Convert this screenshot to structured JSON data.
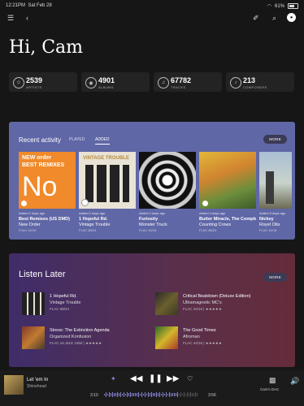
{
  "status": {
    "time": "12:21PM",
    "date": "Sat Feb 28",
    "battery": "61%"
  },
  "greeting": "Hi, Cam",
  "stats": [
    {
      "value": "2539",
      "label": "ARTISTS",
      "icon": "person-icon"
    },
    {
      "value": "4901",
      "label": "ALBUMS",
      "icon": "disc-icon"
    },
    {
      "value": "67782",
      "label": "TRACKS",
      "icon": "music-note-icon"
    },
    {
      "value": "213",
      "label": "COMPOSERS",
      "icon": "composer-icon"
    }
  ],
  "recent": {
    "title": "Recent activity",
    "tabs": [
      "PLAYED",
      "ADDED"
    ],
    "active_tab": "ADDED",
    "more": "MORE",
    "items": [
      {
        "added": "Added 2 days ago",
        "title": "Best Remixes (US DMD)",
        "artist": "New Order",
        "format": "FLAC 44/16",
        "cover_text_1": "NEW order",
        "cover_text_2": "BEST REMIXES",
        "cover_text_3": "No"
      },
      {
        "added": "Added 2 days ago",
        "title": "1 Hopeful Rd.",
        "artist": "Vintage Trouble",
        "format": "FLAC 88/24",
        "cover_text_1": "VINTAGE TROUBLE"
      },
      {
        "added": "Added 4 days ago",
        "title": "Furiosity",
        "artist": "Monster Truck",
        "format": "FLAC 44/16"
      },
      {
        "added": "Added 4 days ago",
        "title": "Butter Miracle, The Complete",
        "artist": "Counting Crows",
        "format": "FLAC 88/24"
      },
      {
        "added": "Added 5 days ago",
        "title": "Nickey",
        "artist": "Royel Otis",
        "format": "FLAC 44/16"
      }
    ]
  },
  "later": {
    "title": "Listen Later",
    "more": "MORE",
    "items": [
      {
        "title": "1 Hopeful Rd.",
        "artist": "Vintage Trouble",
        "format": "FLAC 88/24"
      },
      {
        "title": "Critical Beatdown (Deluxe Edition)",
        "artist": "Ultramagnetic MC's",
        "format": "FLAC 44/16 | ★★★★★"
      },
      {
        "title": "Stress: The Extinction Agenda",
        "artist": "Organized Konfusion",
        "format": "FLAC 44.1kHz 16bit | ★★★★★"
      },
      {
        "title": "The Good Times",
        "artist": "Afroman",
        "format": "FLAC 44/16 | ★★★★★"
      }
    ]
  },
  "player": {
    "title": "Let 'em In",
    "artist": "Shinehead",
    "elapsed": "3:10",
    "duration": "3:56",
    "zone": "Cam's DAC",
    "progress": 0.8
  }
}
